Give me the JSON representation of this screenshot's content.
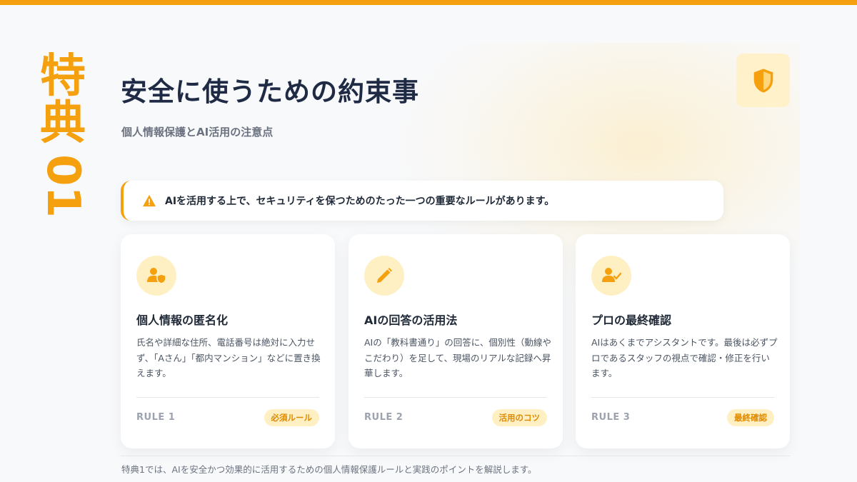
{
  "colors": {
    "accent": "#f5a00f",
    "accent_soft": "#fff0c4",
    "title": "#1f2a44",
    "muted": "#6b7280"
  },
  "side_label": {
    "chars": [
      "特",
      "典"
    ],
    "number": "01"
  },
  "header": {
    "title": "安全に使うための約束事",
    "subtitle": "個人情報保護とAI活用の注意点",
    "icon": "shield-icon"
  },
  "alert": {
    "icon": "warning-icon",
    "text": "AIを活用する上で、セキュリティを保つためのたった一つの重要なルールがあります。"
  },
  "cards": [
    {
      "icon": "user-shield-icon",
      "heading": "個人情報の匿名化",
      "description": "氏名や詳細な住所、電話番号は絶対に入力せず、「Aさん」「都内マンション」などに置き換えます。",
      "rule": "RULE 1",
      "badge": "必須ルール"
    },
    {
      "icon": "pen-icon",
      "heading": "AIの回答の活用法",
      "description": "AIの「教科書通り」の回答に、個別性（動線やこだわり）を足して、現場のリアルな記録へ昇華します。",
      "rule": "RULE 2",
      "badge": "活用のコツ"
    },
    {
      "icon": "user-check-icon",
      "heading": "プロの最終確認",
      "description": "AIはあくまでアシスタントです。最後は必ずプロであるスタッフの視点で確認・修正を行います。",
      "rule": "RULE 3",
      "badge": "最終確認"
    }
  ],
  "footer": {
    "text": "特典1では、AIを安全かつ効果的に活用するための個人情報保護ルールと実践のポイントを解説します。"
  }
}
